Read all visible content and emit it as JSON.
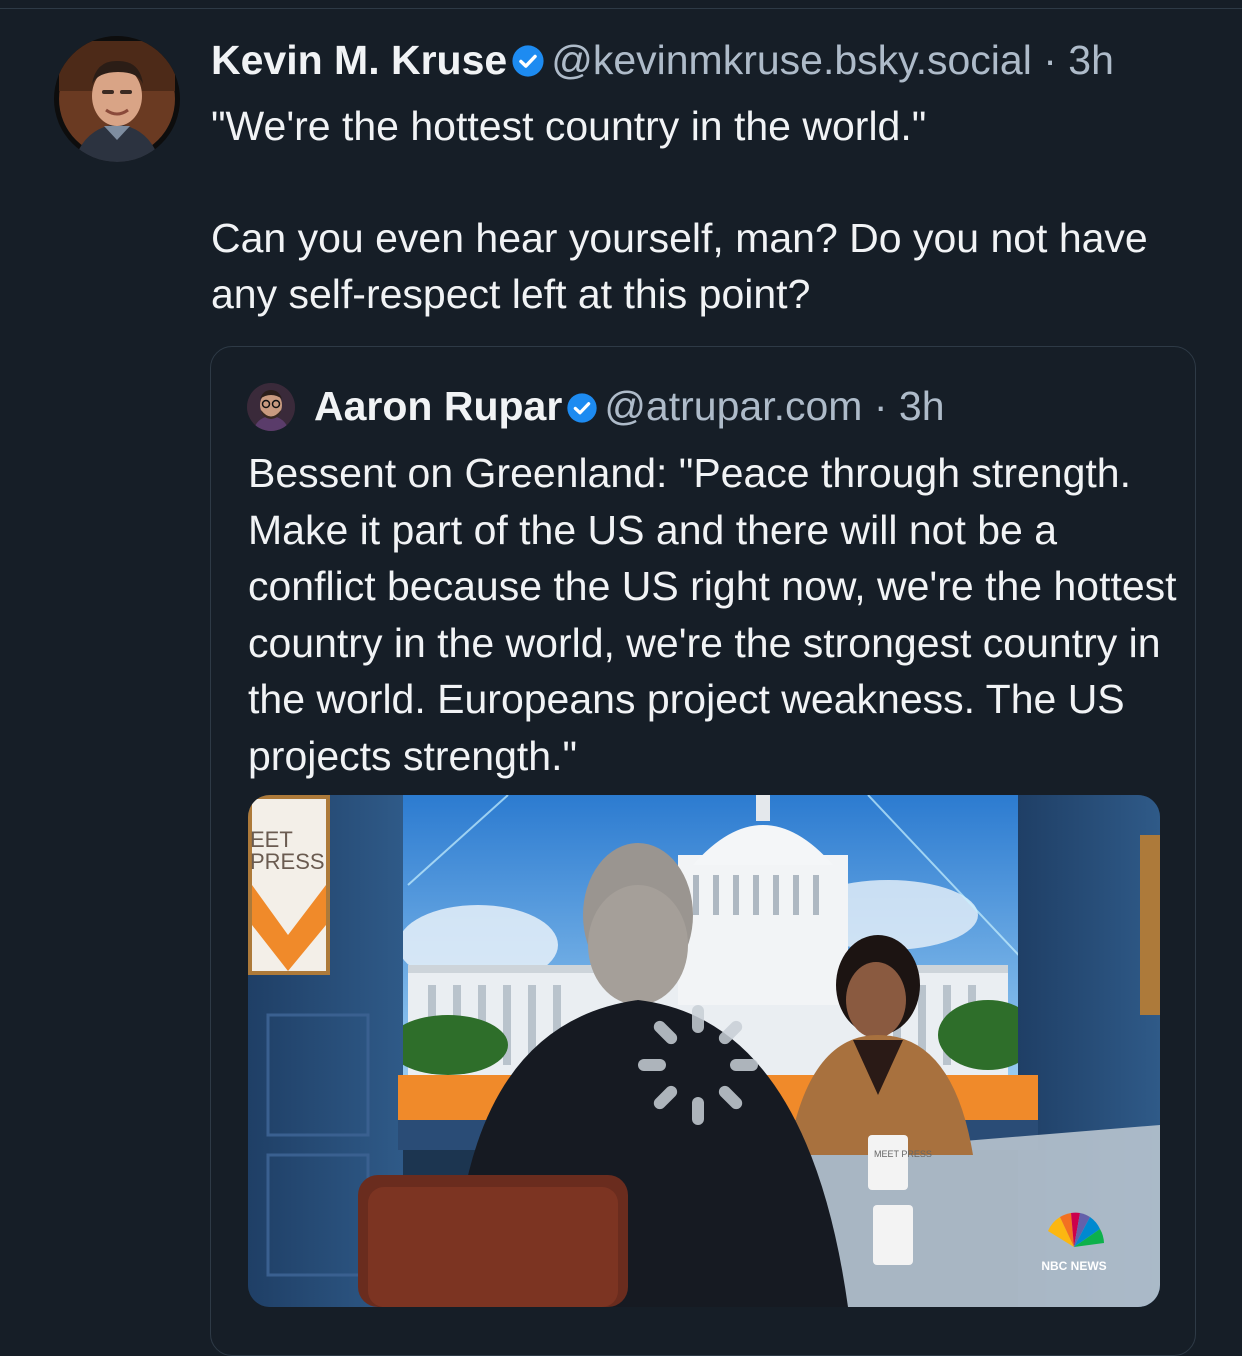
{
  "post": {
    "author": {
      "display_name": "Kevin M. Kruse",
      "handle": "@kevinmkruse.bsky.social",
      "verified": true,
      "avatar_icon": "avatar-photo-icon"
    },
    "separator": "·",
    "time": "3h",
    "text_line_1": "\"We're the hottest country in the world.\"",
    "text_line_2": "Can you even hear yourself, man? Do you not have any self-respect left at this point?"
  },
  "quote": {
    "author": {
      "display_name": "Aaron Rupar",
      "handle": "@atrupar.com",
      "verified": true,
      "avatar_icon": "avatar-photo-icon"
    },
    "separator": "·",
    "time": "3h",
    "text": "Bessent on Greenland: \"Peace through strength. Make it part of the US and there will not be a conflict because the US right now, we're the hottest country in the world, we're the strongest country in the world. Europeans project weakness. The US projects strength.\"",
    "media": {
      "type": "video-thumbnail",
      "logo_text": "NBC NEWS",
      "set_sign_line_1": "EET",
      "set_sign_line_2": "PRESS",
      "mug_text": "MEET PRESS",
      "loading_icon": "loading-spinner-icon"
    }
  },
  "colors": {
    "background": "#161e27",
    "text": "#f1f3f5",
    "muted": "#aebbc9",
    "verified": "#1d8bf1",
    "border": "#2e3a46"
  }
}
